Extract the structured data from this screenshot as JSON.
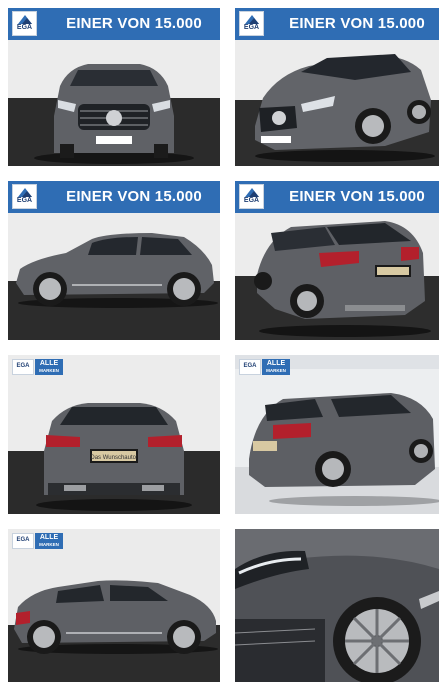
{
  "gallery": {
    "banner_text": "EINER VON 15.000",
    "ega_logo_text": "EGA",
    "badge_line1": "ALLE",
    "badge_line2": "MARKEN",
    "dealer_plate": "Das Wunschauto!",
    "photos": [
      {
        "view": "front",
        "banner": "large"
      },
      {
        "view": "front-three-quarter",
        "banner": "large"
      },
      {
        "view": "side",
        "banner": "large"
      },
      {
        "view": "rear-three-quarter",
        "banner": "large"
      },
      {
        "view": "rear",
        "banner": "badge"
      },
      {
        "view": "rear-three-quarter-showroom",
        "banner": "badge"
      },
      {
        "view": "side-showroom",
        "banner": "badge"
      },
      {
        "view": "detail-headlight-wheel",
        "banner": "none"
      }
    ]
  },
  "colors": {
    "banner_blue": "#2f6db4",
    "car_grey": "#5d5f63",
    "wall": "#e9e9e9",
    "floor": "#2a2a2a"
  }
}
